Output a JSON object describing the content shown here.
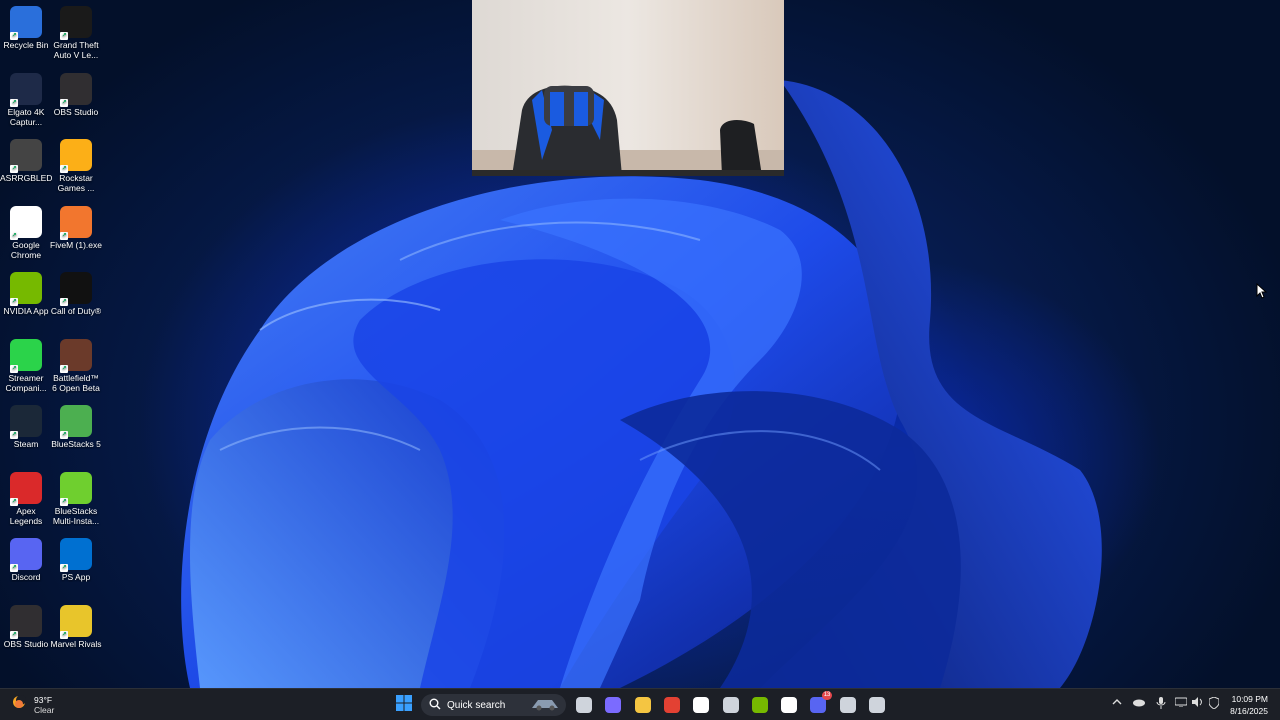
{
  "desktop_icons": [
    {
      "label": "Recycle Bin",
      "icon": "recycle-bin-icon",
      "color": "#2a6fdb"
    },
    {
      "label": "Grand Theft Auto V Le...",
      "icon": "gta-v-icon",
      "color": "#1a1a1a"
    },
    {
      "label": "Elgato 4K Captur...",
      "icon": "elgato-icon",
      "color": "#1e2a48"
    },
    {
      "label": "OBS Studio",
      "icon": "obs-icon",
      "color": "#302e31"
    },
    {
      "label": "ASRRGBLED",
      "icon": "asrock-icon",
      "color": "#444444"
    },
    {
      "label": "Rockstar Games ...",
      "icon": "rockstar-icon",
      "color": "#fcaf17"
    },
    {
      "label": "Google Chrome",
      "icon": "chrome-icon",
      "color": "#ffffff"
    },
    {
      "label": "FiveM (1).exe",
      "icon": "fivem-icon",
      "color": "#f2762e"
    },
    {
      "label": "NVIDIA App",
      "icon": "nvidia-icon",
      "color": "#76b900"
    },
    {
      "label": "Call of Duty®",
      "icon": "cod-icon",
      "color": "#111111"
    },
    {
      "label": "Streamer Compani...",
      "icon": "streamer-companion-icon",
      "color": "#2bd34a"
    },
    {
      "label": "Battlefield™ 6 Open Beta",
      "icon": "battlefield-icon",
      "color": "#6b3a2a"
    },
    {
      "label": "Steam",
      "icon": "steam-icon",
      "color": "#1b2838"
    },
    {
      "label": "BlueStacks 5",
      "icon": "bluestacks-icon",
      "color": "#4caf50"
    },
    {
      "label": "Apex Legends",
      "icon": "apex-icon",
      "color": "#da292a"
    },
    {
      "label": "BlueStacks Multi-Insta...",
      "icon": "bluestacks-multi-icon",
      "color": "#6fcf2f"
    },
    {
      "label": "Discord",
      "icon": "discord-icon",
      "color": "#5865f2"
    },
    {
      "label": "PS App",
      "icon": "ps-app-icon",
      "color": "#0070d1"
    },
    {
      "label": "OBS Studio",
      "icon": "obs-icon",
      "color": "#302e31"
    },
    {
      "label": "Marvel Rivals",
      "icon": "marvel-rivals-icon",
      "color": "#e8c52b"
    }
  ],
  "taskbar": {
    "weather": {
      "temp": "93°F",
      "condition": "Clear"
    },
    "search_placeholder": "Quick search",
    "apps": [
      {
        "name": "task-view-icon",
        "color": "#cfd4dc"
      },
      {
        "name": "copilot-icon",
        "color": "#7b6bff"
      },
      {
        "name": "file-explorer-icon",
        "color": "#f4c542"
      },
      {
        "name": "chrome-icon",
        "color": "#e34133"
      },
      {
        "name": "microsoft-store-icon",
        "color": "#ffffff"
      },
      {
        "name": "keyboard-icon",
        "color": "#cfd4dc"
      },
      {
        "name": "nvidia-icon",
        "color": "#76b900"
      },
      {
        "name": "unreal-icon",
        "color": "#ffffff"
      },
      {
        "name": "discord-icon",
        "color": "#5865f2"
      },
      {
        "name": "obs-icon",
        "color": "#cfd4dc"
      },
      {
        "name": "elgato-4k-icon",
        "color": "#cfd4dc"
      }
    ],
    "discord_badge": "13",
    "clock": {
      "time": "10:09 PM",
      "date": "8/16/2025"
    }
  }
}
